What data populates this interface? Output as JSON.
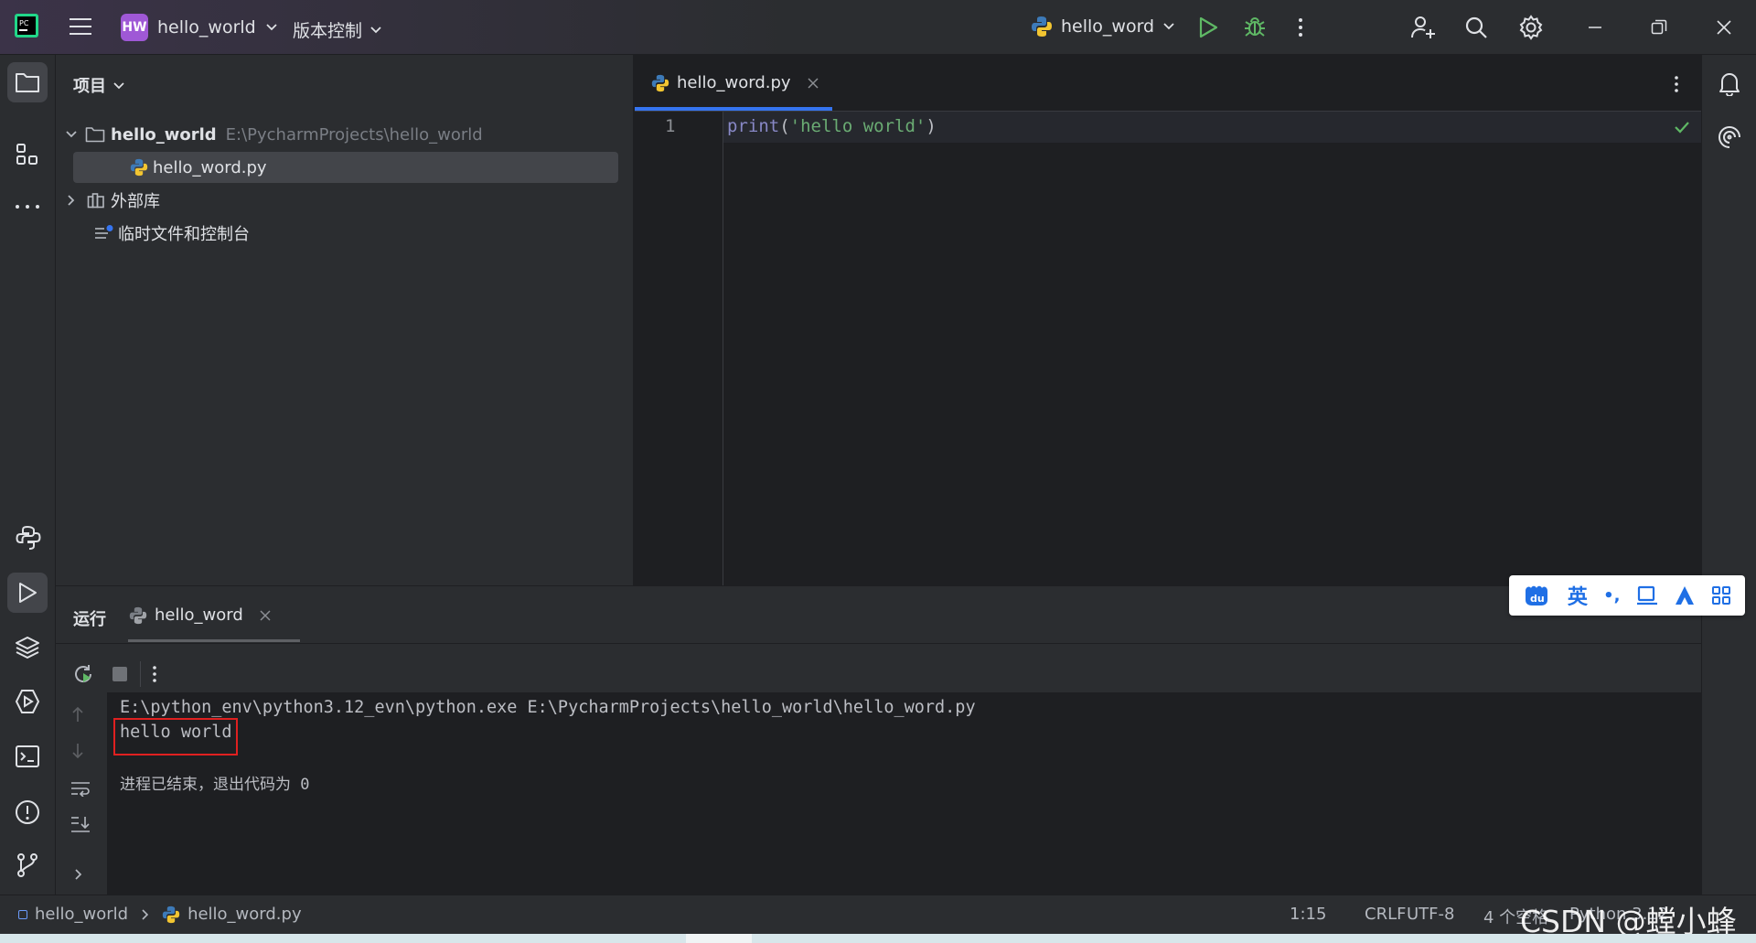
{
  "titlebar": {
    "project_badge": "HW",
    "project_name": "hello_world",
    "vcs_label": "版本控制",
    "run_config": "hello_word",
    "colors": {
      "badge": "#9f58d6",
      "run": "#5fb865",
      "accent": "#3574f0"
    }
  },
  "project_panel": {
    "title": "项目",
    "root_name": "hello_world",
    "root_path": "E:\\PycharmProjects\\hello_world",
    "file_name": "hello_word.py",
    "external_libs": "外部库",
    "scratches": "临时文件和控制台"
  },
  "editor": {
    "tab_label": "hello_word.py",
    "line_number": "1",
    "code": {
      "func": "print",
      "open_paren": "(",
      "string": "'hello world'",
      "close_paren": ")"
    }
  },
  "run_panel": {
    "title": "运行",
    "tab_label": "hello_word",
    "command_line": "E:\\python_env\\python3.12_evn\\python.exe E:\\PycharmProjects\\hello_world\\hello_word.py",
    "output_line": "hello world",
    "exit_message": "进程已结束，退出代码为 0"
  },
  "statusbar": {
    "crumb_project": "hello_world",
    "crumb_file": "hello_word.py",
    "cursor_pos": "1:15",
    "line_sep": "CRLF",
    "encoding": "UTF-8",
    "indent": "4 个空格",
    "interpreter": "Python 3.12",
    "watermark": "CSDN @螳小蜂"
  },
  "ime": {
    "lang": "英",
    "punct": "•,"
  }
}
